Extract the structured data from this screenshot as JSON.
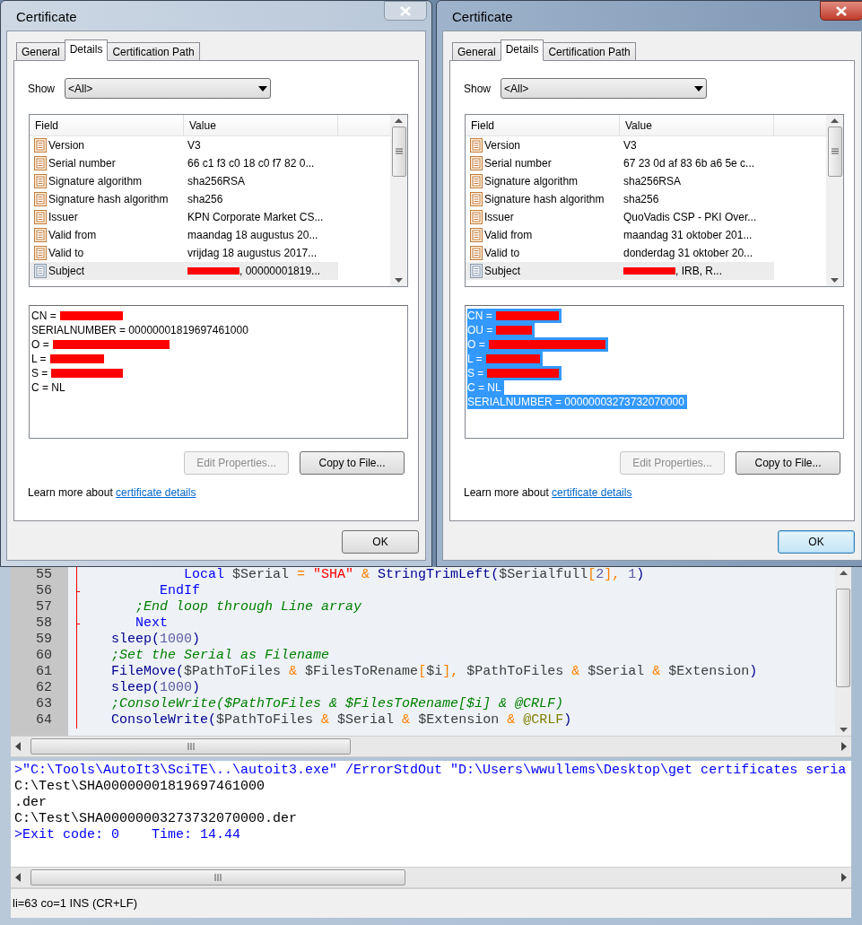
{
  "dialogs": [
    {
      "title": "Certificate",
      "active": false,
      "tabs": [
        {
          "label": "General",
          "selected": false
        },
        {
          "label": "Details",
          "selected": true
        },
        {
          "label": "Certification Path",
          "selected": false
        }
      ],
      "show": {
        "label": "Show",
        "value": "<All>"
      },
      "columns": [
        "Field",
        "Value"
      ],
      "fields": [
        {
          "name": "Version",
          "value": "V3",
          "redacted": false,
          "selected": false
        },
        {
          "name": "Serial number",
          "value": "66 c1 f3 c0 18 c0 f7 82 0...",
          "redacted": false,
          "selected": false
        },
        {
          "name": "Signature algorithm",
          "value": "sha256RSA",
          "redacted": false,
          "selected": false
        },
        {
          "name": "Signature hash algorithm",
          "value": "sha256",
          "redacted": false,
          "selected": false
        },
        {
          "name": "Issuer",
          "value": "KPN Corporate Market CS...",
          "redacted": false,
          "selected": false
        },
        {
          "name": "Valid from",
          "value": "maandag 18 augustus 20...",
          "redacted": false,
          "selected": false
        },
        {
          "name": "Valid to",
          "value": "vrijdag 18 augustus 2017...",
          "redacted": false,
          "selected": false
        },
        {
          "name": "Subject",
          "value": ", 00000001819...",
          "redacted": true,
          "selected": true
        }
      ],
      "details": [
        {
          "text": "CN =",
          "redacted": true,
          "selected": false
        },
        {
          "text": "SERIALNUMBER = 00000001819697461000",
          "redacted": false,
          "selected": false
        },
        {
          "text": "O =",
          "redacted": true,
          "selected": false
        },
        {
          "text": "L =",
          "redacted": true,
          "selected": false
        },
        {
          "text": "S =",
          "redacted": true,
          "selected": false
        },
        {
          "text": "C = NL",
          "redacted": false,
          "selected": false
        }
      ],
      "buttons": [
        {
          "label": "Edit Properties...",
          "disabled": true
        },
        {
          "label": "Copy to File...",
          "disabled": false
        }
      ],
      "learn_more": {
        "text": "Learn more about",
        "link": "certificate details"
      },
      "ok": {
        "label": "OK",
        "default": false
      }
    },
    {
      "title": "Certificate",
      "active": true,
      "tabs": [
        {
          "label": "General",
          "selected": false
        },
        {
          "label": "Details",
          "selected": true
        },
        {
          "label": "Certification Path",
          "selected": false
        }
      ],
      "show": {
        "label": "Show",
        "value": "<All>"
      },
      "columns": [
        "Field",
        "Value"
      ],
      "fields": [
        {
          "name": "Version",
          "value": "V3",
          "redacted": false,
          "selected": false
        },
        {
          "name": "Serial number",
          "value": "67 23 0d af 83 6b a6 5e c...",
          "redacted": false,
          "selected": false
        },
        {
          "name": "Signature algorithm",
          "value": "sha256RSA",
          "redacted": false,
          "selected": false
        },
        {
          "name": "Signature hash algorithm",
          "value": "sha256",
          "redacted": false,
          "selected": false
        },
        {
          "name": "Issuer",
          "value": "QuoVadis CSP - PKI Over...",
          "redacted": false,
          "selected": false
        },
        {
          "name": "Valid from",
          "value": "maandag 31 oktober 201...",
          "redacted": false,
          "selected": false
        },
        {
          "name": "Valid to",
          "value": "donderdag 31 oktober 20...",
          "redacted": false,
          "selected": false
        },
        {
          "name": "Subject",
          "value": ", IRB, R...",
          "redacted": true,
          "selected": true
        }
      ],
      "details": [
        {
          "text": "CN =",
          "redacted": true,
          "selected": true
        },
        {
          "text": "OU =",
          "redacted": true,
          "selected": true
        },
        {
          "text": "O =",
          "redacted": true,
          "selected": true
        },
        {
          "text": "L =",
          "redacted": true,
          "selected": true
        },
        {
          "text": "S =",
          "redacted": true,
          "selected": true
        },
        {
          "text": "C = NL",
          "redacted": false,
          "selected": true
        },
        {
          "text": "SERIALNUMBER = 00000003273732070000",
          "redacted": false,
          "selected": true
        }
      ],
      "buttons": [
        {
          "label": "Edit Properties...",
          "disabled": true
        },
        {
          "label": "Copy to File...",
          "disabled": false
        }
      ],
      "learn_more": {
        "text": "Learn more about",
        "link": "certificate details"
      },
      "ok": {
        "label": "OK",
        "default": true
      }
    }
  ],
  "editor": {
    "lines": [
      {
        "number": "55",
        "fold_end": false,
        "tokens": [
          {
            "kind": "kw",
            "text": "             Local"
          },
          {
            "kind": "var",
            "text": " $Serial"
          },
          {
            "kind": "op",
            "text": " = "
          },
          {
            "kind": "str",
            "text": "\"SHA\""
          },
          {
            "kind": "op",
            "text": " & "
          },
          {
            "kind": "fn",
            "text": "StringTrimLeft"
          },
          {
            "kind": "paren",
            "text": "("
          },
          {
            "kind": "var",
            "text": "$Serialfull"
          },
          {
            "kind": "op",
            "text": "["
          },
          {
            "kind": "num",
            "text": "2"
          },
          {
            "kind": "op",
            "text": "], "
          },
          {
            "kind": "num",
            "text": "1"
          },
          {
            "kind": "paren",
            "text": ")"
          }
        ]
      },
      {
        "number": "56",
        "fold_end": true,
        "tokens": [
          {
            "kind": "kw",
            "text": "          EndIf"
          }
        ]
      },
      {
        "number": "57",
        "fold_end": false,
        "tokens": [
          {
            "kind": "com",
            "text": "       ;End loop through Line array"
          }
        ]
      },
      {
        "number": "58",
        "fold_end": true,
        "tokens": [
          {
            "kind": "kw",
            "text": "       Next"
          }
        ]
      },
      {
        "number": "59",
        "fold_end": false,
        "tokens": [
          {
            "kind": "fn",
            "text": "    sleep"
          },
          {
            "kind": "paren",
            "text": "("
          },
          {
            "kind": "num",
            "text": "1000"
          },
          {
            "kind": "paren",
            "text": ")"
          }
        ]
      },
      {
        "number": "60",
        "fold_end": false,
        "tokens": [
          {
            "kind": "com",
            "text": "    ;Set the Serial as Filename"
          }
        ]
      },
      {
        "number": "61",
        "fold_end": false,
        "tokens": [
          {
            "kind": "fn",
            "text": "    FileMove"
          },
          {
            "kind": "paren",
            "text": "("
          },
          {
            "kind": "var",
            "text": "$PathToFiles"
          },
          {
            "kind": "op",
            "text": " & "
          },
          {
            "kind": "var",
            "text": "$FilesToRename"
          },
          {
            "kind": "op",
            "text": "["
          },
          {
            "kind": "var",
            "text": "$i"
          },
          {
            "kind": "op",
            "text": "], "
          },
          {
            "kind": "var",
            "text": "$PathToFiles"
          },
          {
            "kind": "op",
            "text": " & "
          },
          {
            "kind": "var",
            "text": "$Serial"
          },
          {
            "kind": "op",
            "text": " & "
          },
          {
            "kind": "var",
            "text": "$Extension"
          },
          {
            "kind": "paren",
            "text": ")"
          }
        ]
      },
      {
        "number": "62",
        "fold_end": false,
        "tokens": [
          {
            "kind": "fn",
            "text": "    sleep"
          },
          {
            "kind": "paren",
            "text": "("
          },
          {
            "kind": "num",
            "text": "1000"
          },
          {
            "kind": "paren",
            "text": ")"
          }
        ]
      },
      {
        "number": "63",
        "fold_end": false,
        "tokens": [
          {
            "kind": "com",
            "text": "    ;ConsoleWrite($PathToFiles & $FilesToRename[$i] & @CRLF)"
          }
        ]
      },
      {
        "number": "64",
        "fold_end": false,
        "tokens": [
          {
            "kind": "fn",
            "text": "    ConsoleWrite"
          },
          {
            "kind": "paren",
            "text": "("
          },
          {
            "kind": "var",
            "text": "$PathToFiles"
          },
          {
            "kind": "op",
            "text": " & "
          },
          {
            "kind": "var",
            "text": "$Serial"
          },
          {
            "kind": "op",
            "text": " & "
          },
          {
            "kind": "var",
            "text": "$Extension"
          },
          {
            "kind": "op",
            "text": " & "
          },
          {
            "kind": "macro",
            "text": "@CRLF"
          },
          {
            "kind": "paren",
            "text": ")"
          }
        ]
      }
    ]
  },
  "output": [
    {
      "kind": "info",
      "text": ">\"C:\\Tools\\AutoIt3\\SciTE\\..\\autoit3.exe\" /ErrorStdOut \"D:\\Users\\wwullems\\Desktop\\get certificates seria"
    },
    {
      "kind": "plain",
      "text": "C:\\Test\\SHA00000001819697461000"
    },
    {
      "kind": "plain",
      "text": ".der"
    },
    {
      "kind": "plain",
      "text": "C:\\Test\\SHA00000003273732070000.der"
    },
    {
      "kind": "info",
      "text": ">Exit code: 0    Time: 14.44"
    }
  ],
  "status_bar": "li=63 co=1 INS (CR+LF)"
}
